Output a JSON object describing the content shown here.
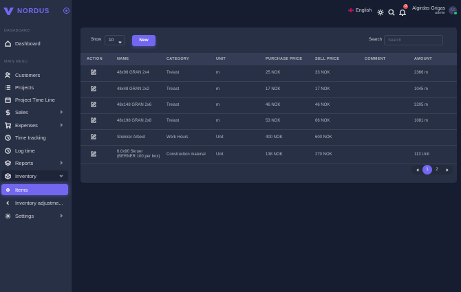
{
  "brand": {
    "name": "NORDUS",
    "color": "#7367f0"
  },
  "sidebar": {
    "section_dashboard": "DASHBOARD",
    "dashboard": "Dashboard",
    "section_main": "MAIN MENU",
    "items": [
      {
        "label": "Customers",
        "icon": "users-icon"
      },
      {
        "label": "Projects",
        "icon": "list-icon"
      },
      {
        "label": "Project Time Line",
        "icon": "calendar-icon"
      },
      {
        "label": "Sales",
        "icon": "dollar-icon"
      },
      {
        "label": "Expenses",
        "icon": "cart-icon"
      },
      {
        "label": "Time tracking",
        "icon": "clock-icon"
      },
      {
        "label": "Log time",
        "icon": "clock-icon"
      },
      {
        "label": "Reports",
        "icon": "layers-icon"
      },
      {
        "label": "Inventory",
        "icon": "box-icon"
      },
      {
        "label": "Items",
        "icon": "circle-icon"
      },
      {
        "label": "Inventory adjustme...",
        "icon": "chevron-left-icon"
      },
      {
        "label": "Settings",
        "icon": "gear-icon"
      }
    ]
  },
  "topbar": {
    "language": "English",
    "notification_count": "0",
    "user_name": "Algirdas Grigas",
    "user_role": "admin",
    "avatar_initials": "AG"
  },
  "toolbar": {
    "show_label": "Show",
    "show_value": "10",
    "new_label": "New",
    "search_label": "Search",
    "search_placeholder": "Search"
  },
  "table": {
    "headers": [
      "ACTION",
      "NAME",
      "CATEGORY",
      "UNIT",
      "PURCHASE PRICE",
      "SELL PRICE",
      "COMMENT",
      "AMOUNT"
    ],
    "rows": [
      {
        "name": "48x98 GRAN 2x4",
        "category": "Trelast",
        "unit": "m",
        "purchase": "25 NOK",
        "sell": "33 NOK",
        "comment": "",
        "amount": "2366 m"
      },
      {
        "name": "48x48 GRAN 2x2",
        "category": "Trelast",
        "unit": "m",
        "purchase": "17 NOK",
        "sell": "17 NOK",
        "comment": "",
        "amount": "1045 m"
      },
      {
        "name": "48x148 GRAN 2x6",
        "category": "Trelast",
        "unit": "m",
        "purchase": "46 NOK",
        "sell": "46 NOK",
        "comment": "",
        "amount": "3205 m"
      },
      {
        "name": "48x198 GRAN 2x8",
        "category": "Trelast",
        "unit": "m",
        "purchase": "53 NOK",
        "sell": "66 NOK",
        "comment": "",
        "amount": "1081 m"
      },
      {
        "name": "Snekker Arbeid",
        "category": "Work Hours",
        "unit": "Unit",
        "purchase": "400 NOK",
        "sell": "600 NOK",
        "comment": "",
        "amount": ""
      },
      {
        "name": "6,0x90 Skruer (BERNER 100 per box)",
        "category": "Construction material",
        "unit": "Unit",
        "purchase": "138 NOK",
        "sell": "270 NOK",
        "comment": "",
        "amount": "113 Unit"
      }
    ]
  },
  "pagination": {
    "pages": [
      "1",
      "2"
    ],
    "current": "1"
  }
}
